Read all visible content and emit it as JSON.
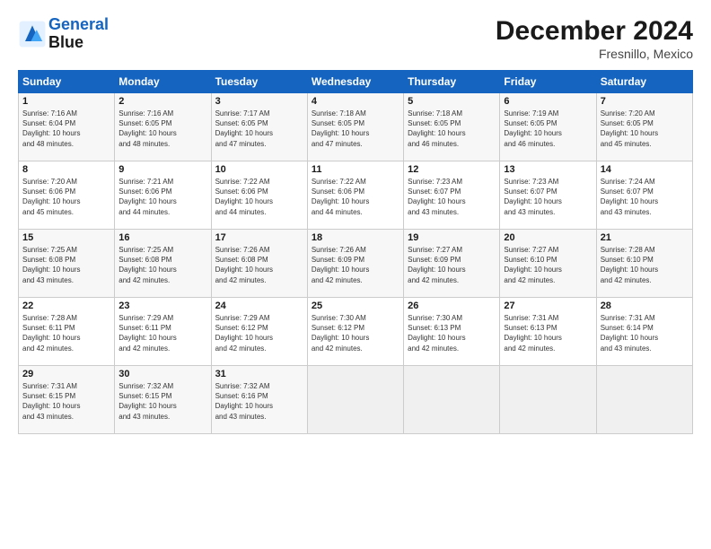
{
  "logo": {
    "line1": "General",
    "line2": "Blue"
  },
  "calendar": {
    "title": "December 2024",
    "subtitle": "Fresnillo, Mexico"
  },
  "headers": [
    "Sunday",
    "Monday",
    "Tuesday",
    "Wednesday",
    "Thursday",
    "Friday",
    "Saturday"
  ],
  "weeks": [
    [
      {
        "day": "1",
        "info": "Sunrise: 7:16 AM\nSunset: 6:04 PM\nDaylight: 10 hours\nand 48 minutes."
      },
      {
        "day": "2",
        "info": "Sunrise: 7:16 AM\nSunset: 6:05 PM\nDaylight: 10 hours\nand 48 minutes."
      },
      {
        "day": "3",
        "info": "Sunrise: 7:17 AM\nSunset: 6:05 PM\nDaylight: 10 hours\nand 47 minutes."
      },
      {
        "day": "4",
        "info": "Sunrise: 7:18 AM\nSunset: 6:05 PM\nDaylight: 10 hours\nand 47 minutes."
      },
      {
        "day": "5",
        "info": "Sunrise: 7:18 AM\nSunset: 6:05 PM\nDaylight: 10 hours\nand 46 minutes."
      },
      {
        "day": "6",
        "info": "Sunrise: 7:19 AM\nSunset: 6:05 PM\nDaylight: 10 hours\nand 46 minutes."
      },
      {
        "day": "7",
        "info": "Sunrise: 7:20 AM\nSunset: 6:05 PM\nDaylight: 10 hours\nand 45 minutes."
      }
    ],
    [
      {
        "day": "8",
        "info": "Sunrise: 7:20 AM\nSunset: 6:06 PM\nDaylight: 10 hours\nand 45 minutes."
      },
      {
        "day": "9",
        "info": "Sunrise: 7:21 AM\nSunset: 6:06 PM\nDaylight: 10 hours\nand 44 minutes."
      },
      {
        "day": "10",
        "info": "Sunrise: 7:22 AM\nSunset: 6:06 PM\nDaylight: 10 hours\nand 44 minutes."
      },
      {
        "day": "11",
        "info": "Sunrise: 7:22 AM\nSunset: 6:06 PM\nDaylight: 10 hours\nand 44 minutes."
      },
      {
        "day": "12",
        "info": "Sunrise: 7:23 AM\nSunset: 6:07 PM\nDaylight: 10 hours\nand 43 minutes."
      },
      {
        "day": "13",
        "info": "Sunrise: 7:23 AM\nSunset: 6:07 PM\nDaylight: 10 hours\nand 43 minutes."
      },
      {
        "day": "14",
        "info": "Sunrise: 7:24 AM\nSunset: 6:07 PM\nDaylight: 10 hours\nand 43 minutes."
      }
    ],
    [
      {
        "day": "15",
        "info": "Sunrise: 7:25 AM\nSunset: 6:08 PM\nDaylight: 10 hours\nand 43 minutes."
      },
      {
        "day": "16",
        "info": "Sunrise: 7:25 AM\nSunset: 6:08 PM\nDaylight: 10 hours\nand 42 minutes."
      },
      {
        "day": "17",
        "info": "Sunrise: 7:26 AM\nSunset: 6:08 PM\nDaylight: 10 hours\nand 42 minutes."
      },
      {
        "day": "18",
        "info": "Sunrise: 7:26 AM\nSunset: 6:09 PM\nDaylight: 10 hours\nand 42 minutes."
      },
      {
        "day": "19",
        "info": "Sunrise: 7:27 AM\nSunset: 6:09 PM\nDaylight: 10 hours\nand 42 minutes."
      },
      {
        "day": "20",
        "info": "Sunrise: 7:27 AM\nSunset: 6:10 PM\nDaylight: 10 hours\nand 42 minutes."
      },
      {
        "day": "21",
        "info": "Sunrise: 7:28 AM\nSunset: 6:10 PM\nDaylight: 10 hours\nand 42 minutes."
      }
    ],
    [
      {
        "day": "22",
        "info": "Sunrise: 7:28 AM\nSunset: 6:11 PM\nDaylight: 10 hours\nand 42 minutes."
      },
      {
        "day": "23",
        "info": "Sunrise: 7:29 AM\nSunset: 6:11 PM\nDaylight: 10 hours\nand 42 minutes."
      },
      {
        "day": "24",
        "info": "Sunrise: 7:29 AM\nSunset: 6:12 PM\nDaylight: 10 hours\nand 42 minutes."
      },
      {
        "day": "25",
        "info": "Sunrise: 7:30 AM\nSunset: 6:12 PM\nDaylight: 10 hours\nand 42 minutes."
      },
      {
        "day": "26",
        "info": "Sunrise: 7:30 AM\nSunset: 6:13 PM\nDaylight: 10 hours\nand 42 minutes."
      },
      {
        "day": "27",
        "info": "Sunrise: 7:31 AM\nSunset: 6:13 PM\nDaylight: 10 hours\nand 42 minutes."
      },
      {
        "day": "28",
        "info": "Sunrise: 7:31 AM\nSunset: 6:14 PM\nDaylight: 10 hours\nand 43 minutes."
      }
    ],
    [
      {
        "day": "29",
        "info": "Sunrise: 7:31 AM\nSunset: 6:15 PM\nDaylight: 10 hours\nand 43 minutes."
      },
      {
        "day": "30",
        "info": "Sunrise: 7:32 AM\nSunset: 6:15 PM\nDaylight: 10 hours\nand 43 minutes."
      },
      {
        "day": "31",
        "info": "Sunrise: 7:32 AM\nSunset: 6:16 PM\nDaylight: 10 hours\nand 43 minutes."
      },
      {
        "day": "",
        "info": ""
      },
      {
        "day": "",
        "info": ""
      },
      {
        "day": "",
        "info": ""
      },
      {
        "day": "",
        "info": ""
      }
    ]
  ]
}
